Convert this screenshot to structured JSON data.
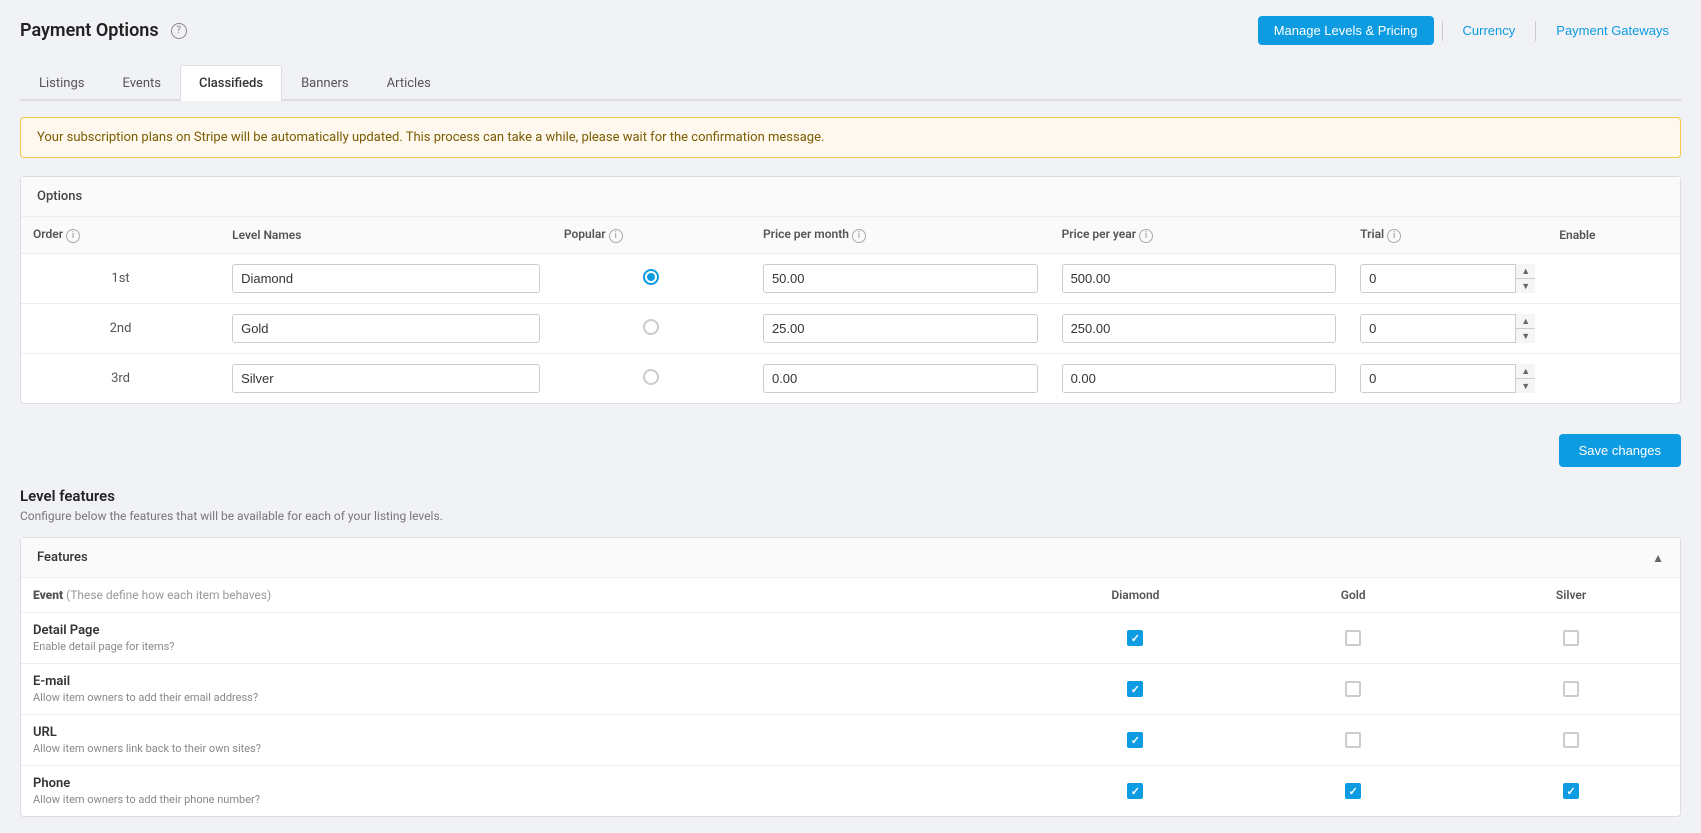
{
  "page": {
    "title": "Payment Options",
    "header_buttons": {
      "manage": "Manage Levels & Pricing",
      "currency": "Currency",
      "gateways": "Payment Gateways"
    }
  },
  "tabs": [
    {
      "id": "listings",
      "label": "Listings",
      "active": false
    },
    {
      "id": "events",
      "label": "Events",
      "active": false
    },
    {
      "id": "classifieds",
      "label": "Classifieds",
      "active": true
    },
    {
      "id": "banners",
      "label": "Banners",
      "active": false
    },
    {
      "id": "articles",
      "label": "Articles",
      "active": false
    }
  ],
  "alert": {
    "message": "Your subscription plans on Stripe will be automatically updated. This process can take a while, please wait for the confirmation message."
  },
  "options_section": {
    "title": "Options",
    "columns": {
      "order": "Order",
      "level_names": "Level Names",
      "popular": "Popular",
      "price_per_month": "Price per month",
      "price_per_year": "Price per year",
      "trial": "Trial",
      "enable": "Enable"
    },
    "rows": [
      {
        "order": "1st",
        "level_name": "Diamond",
        "popular": true,
        "price_month": "50.00",
        "price_year": "500.00",
        "trial": "0",
        "enabled": true
      },
      {
        "order": "2nd",
        "level_name": "Gold",
        "popular": false,
        "price_month": "25.00",
        "price_year": "250.00",
        "trial": "0",
        "enabled": true
      },
      {
        "order": "3rd",
        "level_name": "Silver",
        "popular": false,
        "price_month": "0.00",
        "price_year": "0.00",
        "trial": "0",
        "enabled": true
      }
    ],
    "save_button": "Save changes"
  },
  "level_features": {
    "title": "Level features",
    "subtitle": "Configure below the features that will be available for each of your listing levels.",
    "card_header": "Features",
    "event_label": "Event",
    "event_sub": "(These define how each item behaves)",
    "levels": [
      "Diamond",
      "Gold",
      "Silver"
    ],
    "features": [
      {
        "name": "Detail Page",
        "desc": "Enable detail page for items?",
        "diamond": true,
        "gold": false,
        "silver": false
      },
      {
        "name": "E-mail",
        "desc": "Allow item owners to add their email address?",
        "diamond": true,
        "gold": false,
        "silver": false
      },
      {
        "name": "URL",
        "desc": "Allow item owners link back to their own sites?",
        "diamond": true,
        "gold": false,
        "silver": false
      },
      {
        "name": "Phone",
        "desc": "Allow item owners to add their phone number?",
        "diamond": true,
        "gold": true,
        "silver": true
      }
    ]
  },
  "icons": {
    "help": "?",
    "info": "i",
    "chevron_up": "▲",
    "check": "✓"
  }
}
